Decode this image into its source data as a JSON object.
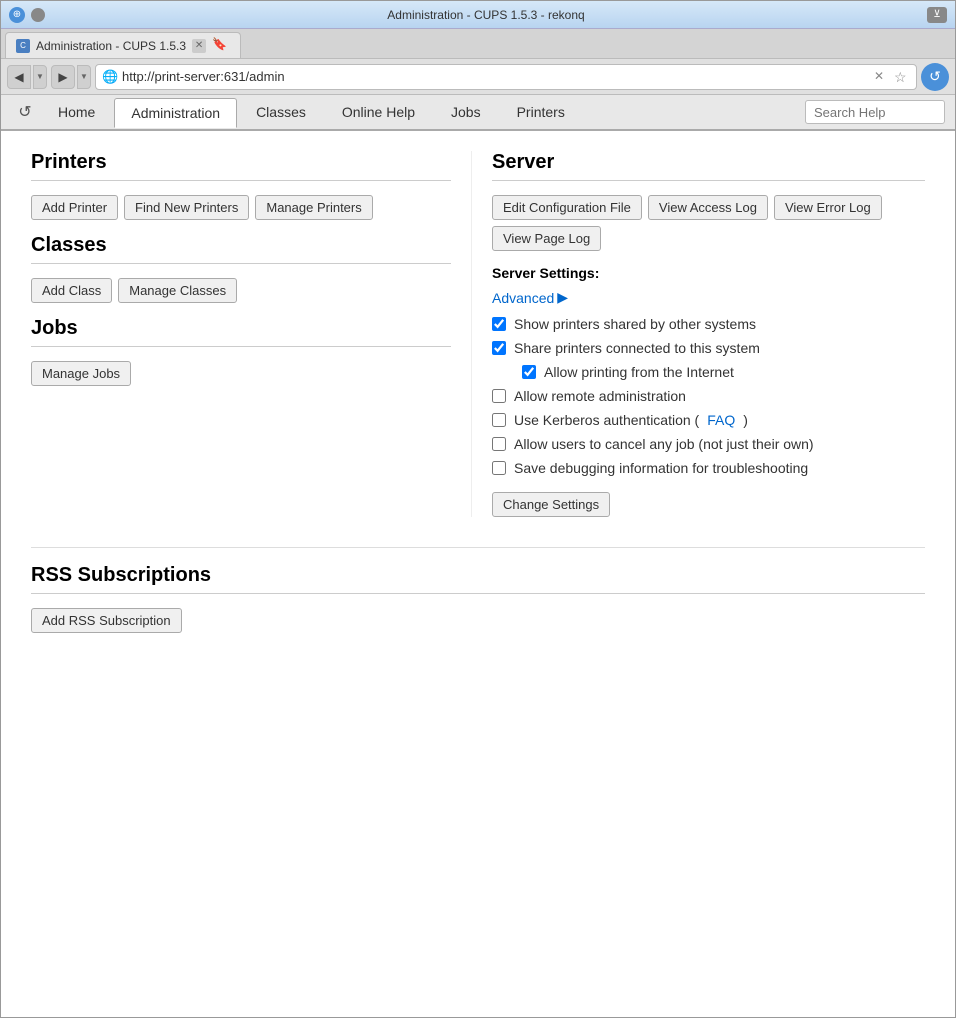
{
  "browser": {
    "title": "Administration - CUPS 1.5.3 - rekonq",
    "tab_title": "Administration - CUPS 1.5.3",
    "url": "http://print-server:631/admin",
    "reload_icon": "↺"
  },
  "cups_nav": {
    "refresh_icon": "↺",
    "tabs": [
      {
        "label": "Home",
        "active": false
      },
      {
        "label": "Administration",
        "active": true
      },
      {
        "label": "Classes",
        "active": false
      },
      {
        "label": "Online Help",
        "active": false
      },
      {
        "label": "Jobs",
        "active": false
      },
      {
        "label": "Printers",
        "active": false
      }
    ],
    "search_placeholder": "Search Help"
  },
  "printers_section": {
    "title": "Printers",
    "buttons": [
      {
        "label": "Add Printer"
      },
      {
        "label": "Find New Printers"
      },
      {
        "label": "Manage Printers"
      }
    ]
  },
  "classes_section": {
    "title": "Classes",
    "buttons": [
      {
        "label": "Add Class"
      },
      {
        "label": "Manage Classes"
      }
    ]
  },
  "jobs_section": {
    "title": "Jobs",
    "buttons": [
      {
        "label": "Manage Jobs"
      }
    ]
  },
  "server_section": {
    "title": "Server",
    "buttons": [
      {
        "label": "Edit Configuration File"
      },
      {
        "label": "View Access Log"
      },
      {
        "label": "View Error Log"
      },
      {
        "label": "View Page Log"
      }
    ],
    "settings_label": "Server Settings:",
    "advanced_label": "Advanced",
    "advanced_arrow": "▶",
    "checkboxes": [
      {
        "label": "Show printers shared by other systems",
        "checked": true,
        "indented": false
      },
      {
        "label": "Share printers connected to this system",
        "checked": true,
        "indented": false
      },
      {
        "label": "Allow printing from the Internet",
        "checked": true,
        "indented": true
      },
      {
        "label": "Allow remote administration",
        "checked": false,
        "indented": false
      },
      {
        "label": "Use Kerberos authentication (",
        "faq": "FAQ",
        "faq_close": ")",
        "checked": false,
        "indented": false,
        "has_faq": true
      },
      {
        "label": "Allow users to cancel any job (not just their own)",
        "checked": false,
        "indented": false
      },
      {
        "label": "Save debugging information for troubleshooting",
        "checked": false,
        "indented": false
      }
    ],
    "change_settings_label": "Change Settings"
  },
  "rss_section": {
    "title": "RSS Subscriptions",
    "buttons": [
      {
        "label": "Add RSS Subscription"
      }
    ]
  }
}
